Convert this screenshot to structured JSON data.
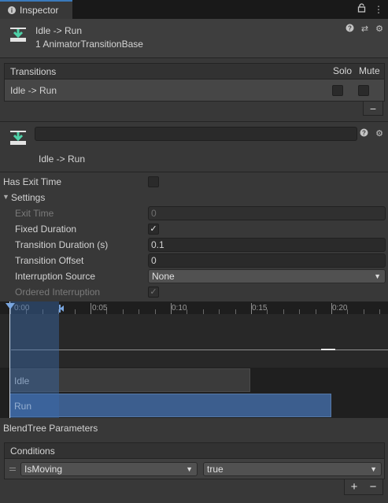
{
  "tab": {
    "title": "Inspector"
  },
  "header": {
    "title": "Idle -> Run",
    "subtitle": "1 AnimatorTransitionBase"
  },
  "transitions": {
    "heading": "Transitions",
    "solo_label": "Solo",
    "mute_label": "Mute",
    "rows": [
      {
        "label": "Idle -> Run",
        "solo": false,
        "mute": false
      }
    ],
    "remove_label": "−"
  },
  "transition": {
    "name_value": "",
    "label": "Idle -> Run"
  },
  "properties": {
    "has_exit_time": {
      "label": "Has Exit Time",
      "checked": false
    },
    "settings": {
      "label": "Settings"
    },
    "exit_time": {
      "label": "Exit Time",
      "value": "0"
    },
    "fixed_duration": {
      "label": "Fixed Duration",
      "checked": true
    },
    "transition_duration": {
      "label": "Transition Duration (s)",
      "value": "0.1"
    },
    "transition_offset": {
      "label": "Transition Offset",
      "value": "0"
    },
    "interruption_source": {
      "label": "Interruption Source",
      "value": "None"
    },
    "ordered_interruption": {
      "label": "Ordered Interruption",
      "checked": true
    }
  },
  "timeline": {
    "ticks": [
      "0:00",
      "0:05",
      "0:10",
      "0:15",
      "0:20"
    ],
    "tracks": {
      "idle": "Idle",
      "run": "Run"
    }
  },
  "blendtree": {
    "label": "BlendTree Parameters"
  },
  "conditions": {
    "heading": "Conditions",
    "rows": [
      {
        "parameter": "IsMoving",
        "value": "true"
      }
    ],
    "add_label": "+",
    "remove_label": "−"
  }
}
